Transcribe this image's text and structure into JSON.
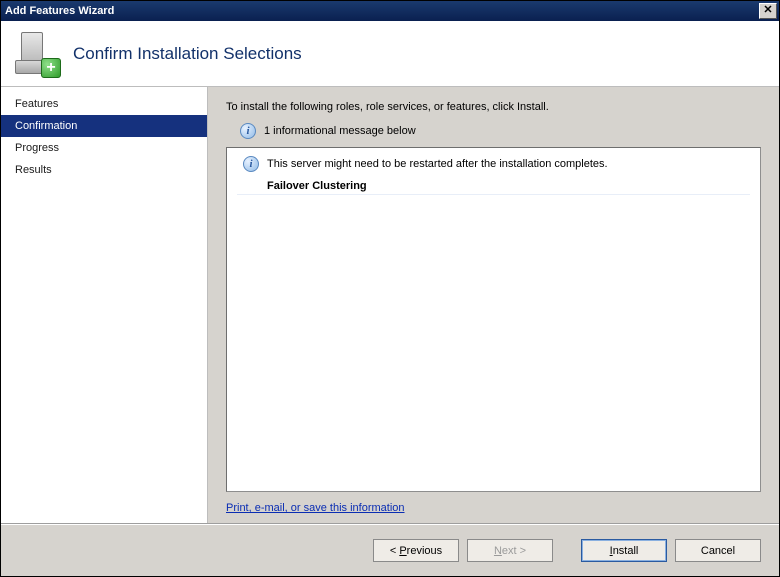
{
  "window": {
    "title": "Add Features Wizard"
  },
  "header": {
    "title": "Confirm Installation Selections"
  },
  "sidebar": {
    "steps": [
      {
        "label": "Features",
        "selected": false
      },
      {
        "label": "Confirmation",
        "selected": true
      },
      {
        "label": "Progress",
        "selected": false
      },
      {
        "label": "Results",
        "selected": false
      }
    ]
  },
  "main": {
    "intro": "To install the following roles, role services, or features, click Install.",
    "info_summary": "1 informational message below",
    "restart_notice": "This server might need to be restarted after the installation completes.",
    "features": [
      "Failover Clustering"
    ],
    "link_text": "Print, e-mail, or save this information"
  },
  "footer": {
    "previous": "< Previous",
    "next": "Next >",
    "install": "Install",
    "cancel": "Cancel"
  }
}
